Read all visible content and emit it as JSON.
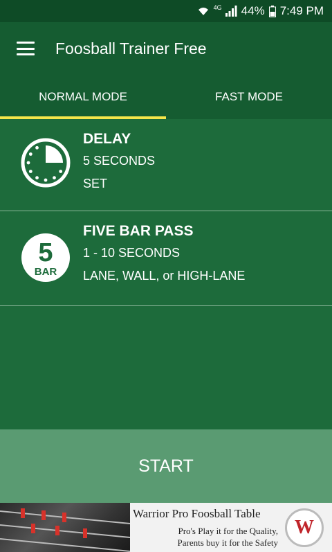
{
  "status_bar": {
    "network": "4G",
    "battery": "44%",
    "time": "7:49 PM"
  },
  "app_bar": {
    "title": "Foosball Trainer Free"
  },
  "tabs": [
    {
      "label": "NORMAL MODE",
      "active": true
    },
    {
      "label": "FAST MODE",
      "active": false
    }
  ],
  "settings": [
    {
      "icon": "clock-icon",
      "title": "DELAY",
      "line1": "5 SECONDS",
      "line2": "SET"
    },
    {
      "icon": "five-bar-icon",
      "icon_number": "5",
      "icon_label": "BAR",
      "title": "FIVE BAR PASS",
      "line1": "1 - 10 SECONDS",
      "line2": "LANE, WALL, or HIGH-LANE"
    }
  ],
  "start_label": "START",
  "ad": {
    "headline": "Warrior Pro Foosball Table",
    "line1": "Pro's Play it for the Quality,",
    "line2": "Parents buy it for the Safety",
    "badge_letter": "W"
  },
  "colors": {
    "primary": "#1d6b3b",
    "app_bar": "#155c31",
    "status_bar": "#0e4b26",
    "tab_indicator": "#f5e64a",
    "start_bg": "#5a9b72"
  }
}
